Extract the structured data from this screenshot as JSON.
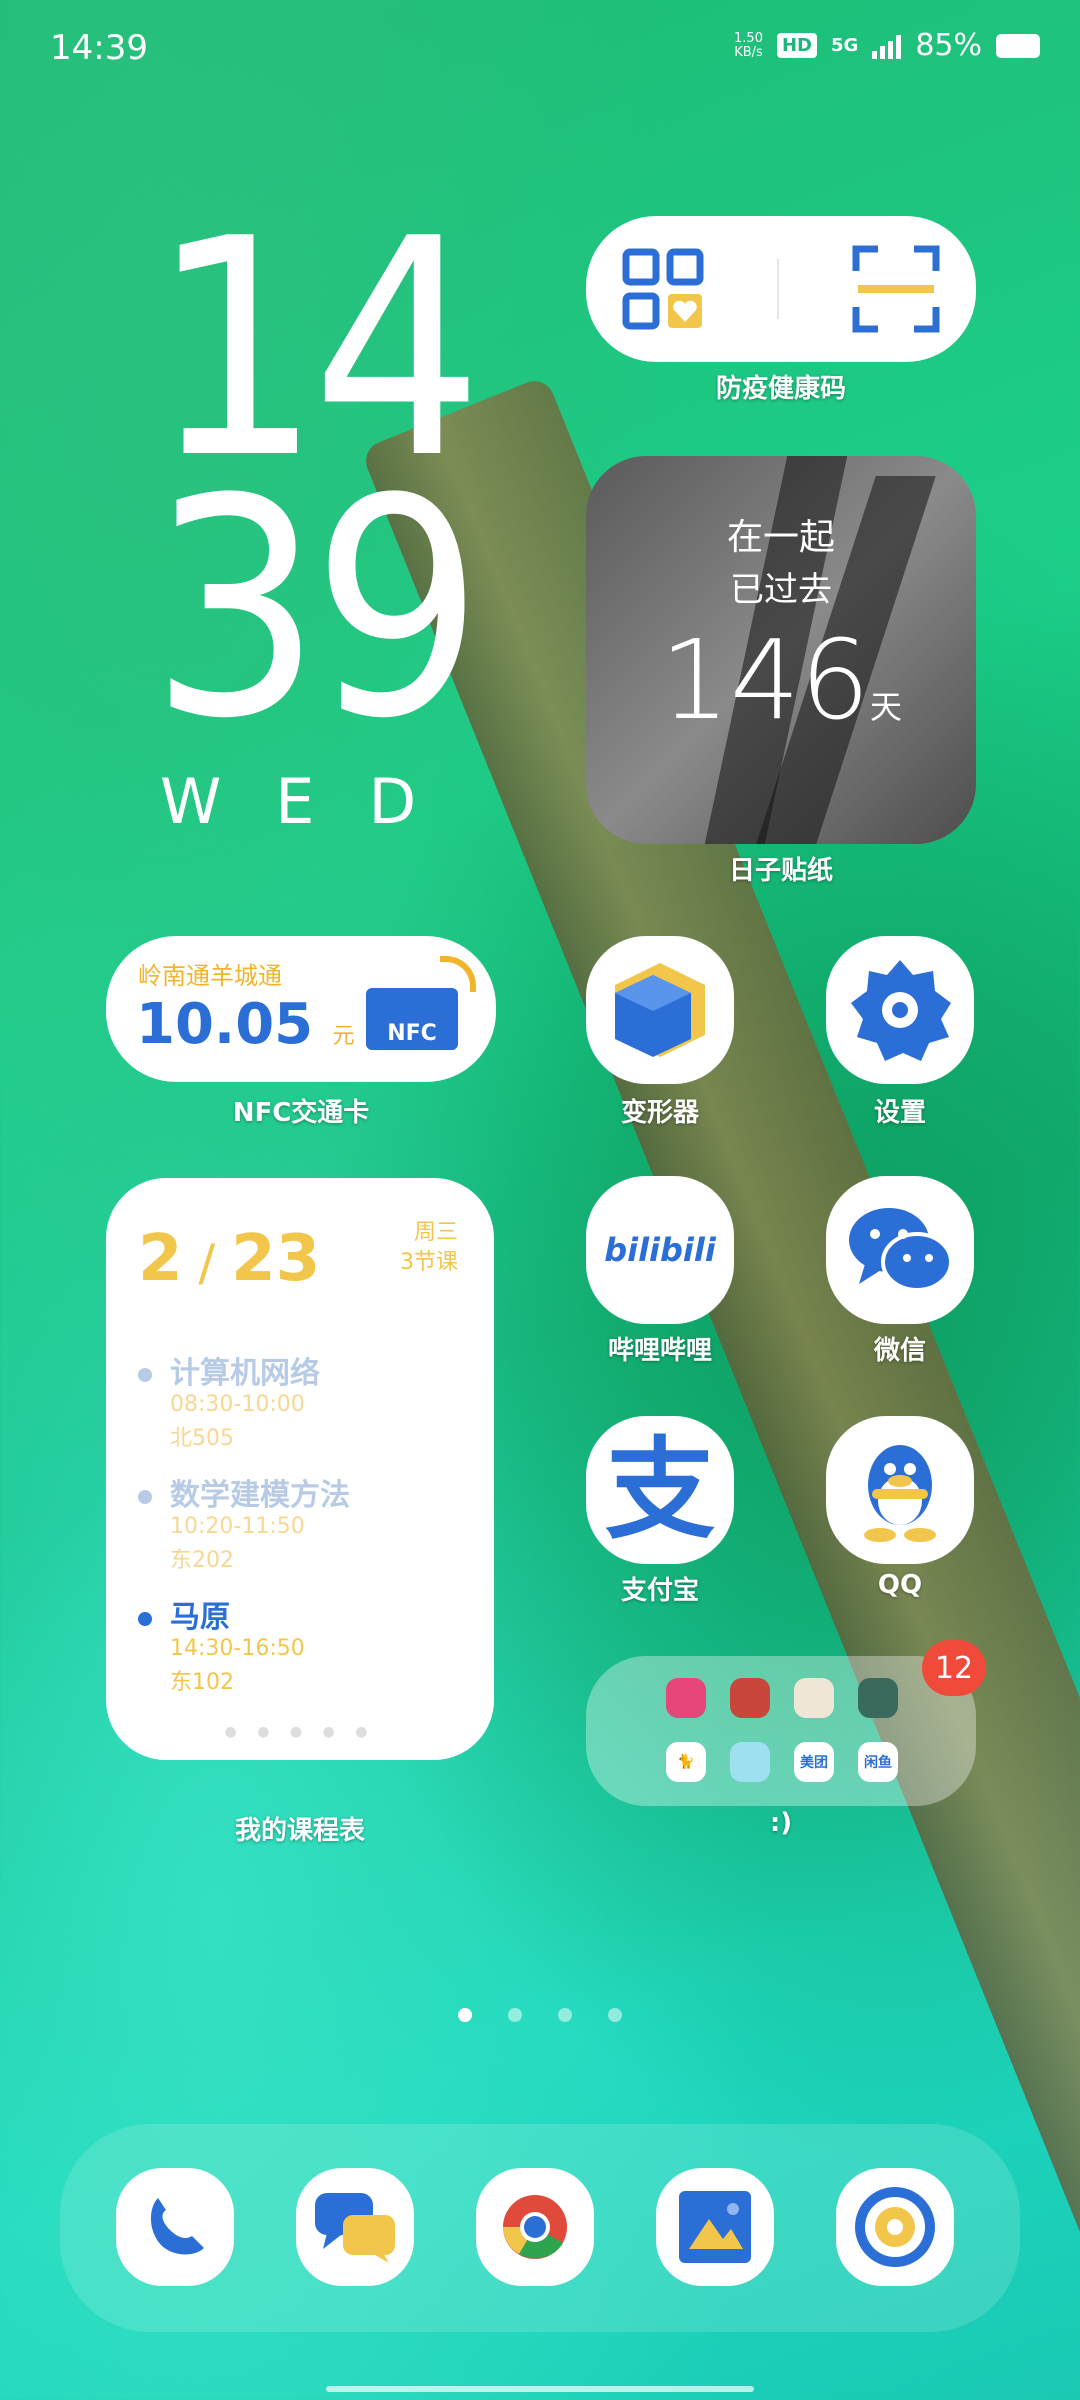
{
  "status_bar": {
    "time": "14:39",
    "net_speed_value": "1.50",
    "net_speed_unit": "KB/s",
    "hd": "HD",
    "network": "5G",
    "battery": "85%"
  },
  "clock_widget": {
    "hour": "14",
    "minute": "39",
    "weekday": "WED"
  },
  "health_widget": {
    "label": "防疫健康码",
    "icons": [
      "health-code-icon",
      "scan-icon"
    ]
  },
  "photo_widget": {
    "line1": "在一起",
    "line2": "已过去",
    "days": "146",
    "unit": "天",
    "label": "日子贴纸"
  },
  "nfc_widget": {
    "card_name": "岭南通羊城通",
    "balance": "10.05",
    "currency": "元",
    "card_text": "NFC",
    "label": "NFC交通卡"
  },
  "apps": [
    {
      "label": "变形器",
      "icon": "transformer-icon"
    },
    {
      "label": "设置",
      "icon": "settings-gear-icon"
    },
    {
      "label": "哔哩哔哩",
      "icon": "bilibili-icon",
      "logo_text": "bilibili"
    },
    {
      "label": "微信",
      "icon": "wechat-icon"
    },
    {
      "label": "支付宝",
      "icon": "alipay-icon",
      "logo_text": "支"
    },
    {
      "label": "QQ",
      "icon": "qq-penguin-icon"
    }
  ],
  "schedule_widget": {
    "date_month": "2",
    "date_day": "23",
    "weekday": "周三",
    "class_count": "3节课",
    "courses": [
      {
        "name": "计算机网络",
        "time": "08:30-10:00",
        "room": "北505"
      },
      {
        "name": "数学建模方法",
        "time": "10:20-11:50",
        "room": "东202"
      },
      {
        "name": "马原",
        "time": "14:30-16:50",
        "room": "东102"
      }
    ],
    "pager": "● ● ● ● ●",
    "label": "我的课程表"
  },
  "folder": {
    "label": ":)",
    "badge": "12",
    "items": [
      "game-1",
      "game-2",
      "game-3",
      "game-4",
      "cat-app",
      "sticker-app",
      "美团",
      "闲鱼"
    ]
  },
  "page_indicator": {
    "pages": 4,
    "active": 0
  },
  "dock": [
    {
      "name": "phone-icon"
    },
    {
      "name": "messages-icon"
    },
    {
      "name": "chrome-icon"
    },
    {
      "name": "gallery-icon"
    },
    {
      "name": "camera-icon"
    }
  ],
  "colors": {
    "accent_blue": "#2b6fd6",
    "accent_yellow": "#f2c64a",
    "badge_red": "#f04b3a"
  }
}
